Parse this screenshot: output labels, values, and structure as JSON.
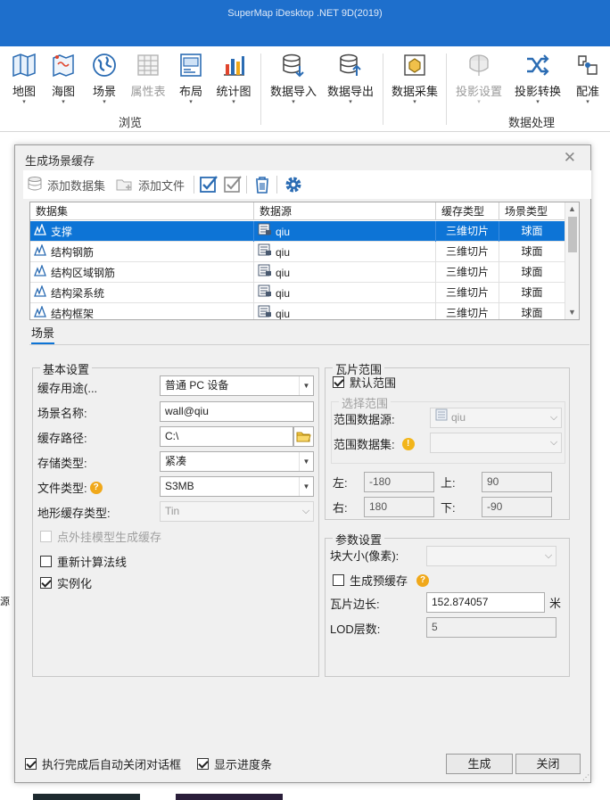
{
  "app": {
    "title": "SuperMap iDesktop .NET 9D(2019)"
  },
  "ribbon": {
    "groups": [
      {
        "label": "浏览",
        "items": [
          {
            "label": "地图",
            "icon": "map-icon",
            "disabled": false
          },
          {
            "label": "海图",
            "icon": "chart-map-icon",
            "disabled": false
          },
          {
            "label": "场景",
            "icon": "globe-icon",
            "disabled": false
          },
          {
            "label": "属性表",
            "icon": "table-icon",
            "disabled": true
          },
          {
            "label": "布局",
            "icon": "layout-icon",
            "disabled": false
          },
          {
            "label": "统计图",
            "icon": "bar-chart-icon",
            "disabled": false
          }
        ]
      },
      {
        "label": "数据处理",
        "items": [
          {
            "label": "数据导入",
            "icon": "database-import-icon",
            "disabled": false
          },
          {
            "label": "数据导出",
            "icon": "database-export-icon",
            "disabled": false
          },
          {
            "label": "数据采集",
            "icon": "data-collect-icon",
            "disabled": false
          },
          {
            "label": "投影设置",
            "icon": "projection-icon",
            "disabled": true
          },
          {
            "label": "投影转换",
            "icon": "shuffle-icon",
            "disabled": false
          },
          {
            "label": "配准",
            "icon": "register-icon",
            "disabled": false
          }
        ]
      }
    ]
  },
  "dialog": {
    "title": "生成场景缓存",
    "close_symbol": "✕",
    "toolbar": {
      "add_dataset": "添加数据集",
      "add_file": "添加文件"
    },
    "grid": {
      "columns": [
        "数据集",
        "数据源",
        "缓存类型",
        "场景类型"
      ],
      "rows": [
        {
          "dataset": "支撑",
          "datasource": "qiu",
          "cache_type": "三维切片",
          "scene_type": "球面",
          "selected": true
        },
        {
          "dataset": "结构钢筋",
          "datasource": "qiu",
          "cache_type": "三维切片",
          "scene_type": "球面",
          "selected": false
        },
        {
          "dataset": "结构区域钢筋",
          "datasource": "qiu",
          "cache_type": "三维切片",
          "scene_type": "球面",
          "selected": false
        },
        {
          "dataset": "结构梁系统",
          "datasource": "qiu",
          "cache_type": "三维切片",
          "scene_type": "球面",
          "selected": false
        },
        {
          "dataset": "结构框架",
          "datasource": "qiu",
          "cache_type": "三维切片",
          "scene_type": "球面",
          "selected": false
        }
      ]
    },
    "tab": "场景",
    "basic": {
      "title": "基本设置",
      "cache_usage_label": "缓存用途(...",
      "cache_usage_value": "普通 PC 设备",
      "scene_name_label": "场景名称:",
      "scene_name_value": "wall@qiu",
      "cache_path_label": "缓存路径:",
      "cache_path_value": "C:\\",
      "storage_type_label": "存储类型:",
      "storage_type_value": "紧凑",
      "file_type_label": "文件类型:",
      "file_type_value": "S3MB",
      "terrain_cache_label": "地形缓存类型:",
      "terrain_cache_value": "Tin",
      "outer_model_label": "点外挂模型生成缓存",
      "recalc_normals_label": "重新计算法线",
      "instancing_label": "实例化"
    },
    "tile_range": {
      "title": "瓦片范围",
      "default_range_label": "默认范围",
      "select_range_title": "选择范围",
      "range_datasource_label": "范围数据源:",
      "range_datasource_value": "qiu",
      "range_dataset_label": "范围数据集:",
      "range_dataset_value": "",
      "left_label": "左:",
      "left_value": "-180",
      "top_label": "上:",
      "top_value": "90",
      "right_label": "右:",
      "right_value": "180",
      "bottom_label": "下:",
      "bottom_value": "-90"
    },
    "params": {
      "title": "参数设置",
      "block_size_label": "块大小(像素):",
      "block_size_value": "",
      "pre_cache_label": "生成预缓存",
      "tile_edge_label": "瓦片边长:",
      "tile_edge_value": "152.874057",
      "tile_edge_unit": "米",
      "lod_label": "LOD层数:",
      "lod_value": "5"
    },
    "footer": {
      "auto_close_label": "执行完成后自动关闭对话框",
      "show_progress_label": "显示进度条",
      "generate_label": "生成",
      "close_label": "关闭"
    }
  },
  "background": {
    "fragment_char": "源"
  }
}
